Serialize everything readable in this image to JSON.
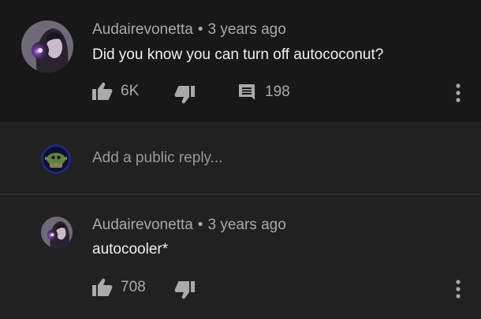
{
  "top_comment": {
    "author": "Audairevonetta",
    "separator": "•",
    "time": "3 years ago",
    "text": "Did you know you can turn off autococonut?",
    "likes": "6K",
    "replies": "198",
    "icons": [
      "avatar",
      "thumbs-up-icon",
      "thumbs-down-icon",
      "reply-icon",
      "more-vert-icon"
    ]
  },
  "reply_input": {
    "placeholder": "Add a public reply..."
  },
  "reply_comment": {
    "author": "Audairevonetta",
    "separator": "•",
    "time": "3 years ago",
    "text": "autocooler*",
    "likes": "708",
    "icons": [
      "avatar",
      "thumbs-up-icon",
      "thumbs-down-icon",
      "more-vert-icon"
    ]
  },
  "colors": {
    "background_dark": "#181818",
    "background_panel": "#212121",
    "text_primary": "#f1f1f1",
    "text_secondary": "#aaaaaa"
  }
}
